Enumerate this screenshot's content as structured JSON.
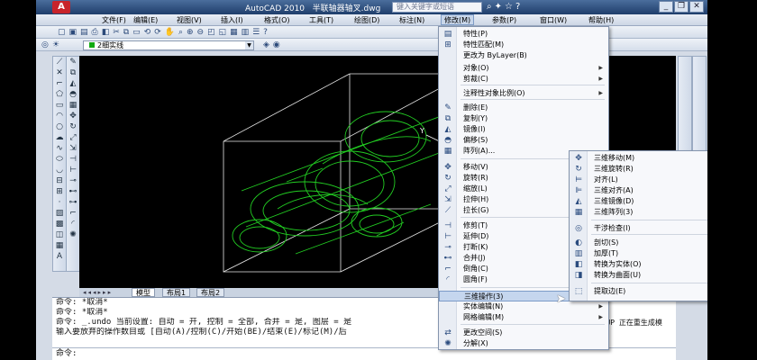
{
  "title": {
    "app": "AutoCAD 2010",
    "file": "半联轴器轴叉.dwg",
    "search_placeholder": "键入关键字或短语",
    "logo_text": "A"
  },
  "menubar": [
    {
      "label": "文件(F)"
    },
    {
      "label": "编辑(E)"
    },
    {
      "label": "视图(V)"
    },
    {
      "label": "插入(I)"
    },
    {
      "label": "格式(O)"
    },
    {
      "label": "工具(T)"
    },
    {
      "label": "绘图(D)"
    },
    {
      "label": "标注(N)"
    },
    {
      "label": "修改(M)"
    },
    {
      "label": "参数(P)"
    },
    {
      "label": "窗口(W)"
    },
    {
      "label": "帮助(H)"
    }
  ],
  "layer_combo": {
    "value": "2细实线"
  },
  "tabs": [
    {
      "label": "模型"
    },
    {
      "label": "布局1"
    },
    {
      "label": "布局2"
    }
  ],
  "command": {
    "lines": [
      "命令: *取消*",
      "命令: *取消*",
      "命令: _.undo 当前设置: 自动 = 开, 控制 = 全部, 合并 = 是, 图层 = 是",
      "输入要放弃的操作数目或 [自动(A)/控制(C)/开始(BE)/结束(E)/标记(M)/后"
    ],
    "prompt": "命令:",
    "overflow_text": "GROUP 正在重生成模"
  },
  "modify_menu": {
    "items": [
      {
        "icon": "properties-icon",
        "glyph": "▤",
        "label": "特性(P)",
        "arrow": false
      },
      {
        "icon": "match-properties-icon",
        "glyph": "⊞",
        "label": "特性匹配(M)",
        "arrow": false
      },
      {
        "icon": "",
        "glyph": "",
        "label": "更改为 ByLayer(B)",
        "arrow": false
      },
      {
        "icon": "",
        "glyph": "",
        "label": "对象(O)",
        "arrow": true
      },
      {
        "icon": "",
        "glyph": "",
        "label": "剪裁(C)",
        "arrow": true
      },
      {
        "icon": "",
        "glyph": "",
        "label": "注释性对象比例(O)",
        "arrow": true
      },
      {
        "icon": "erase-icon",
        "glyph": "✎",
        "label": "删除(E)",
        "arrow": false
      },
      {
        "icon": "copy-icon",
        "glyph": "⧉",
        "label": "复制(Y)",
        "arrow": false
      },
      {
        "icon": "mirror-icon",
        "glyph": "◭",
        "label": "镜像(I)",
        "arrow": false
      },
      {
        "icon": "offset-icon",
        "glyph": "◓",
        "label": "偏移(S)",
        "arrow": false
      },
      {
        "icon": "array-icon",
        "glyph": "▦",
        "label": "阵列(A)...",
        "arrow": false
      },
      {
        "icon": "move-icon",
        "glyph": "✥",
        "label": "移动(V)",
        "arrow": false
      },
      {
        "icon": "rotate-icon",
        "glyph": "↻",
        "label": "旋转(R)",
        "arrow": false
      },
      {
        "icon": "scale-icon",
        "glyph": "⤢",
        "label": "缩放(L)",
        "arrow": false
      },
      {
        "icon": "stretch-icon",
        "glyph": "⇲",
        "label": "拉伸(H)",
        "arrow": false
      },
      {
        "icon": "lengthen-icon",
        "glyph": "⟋",
        "label": "拉长(G)",
        "arrow": false
      },
      {
        "icon": "trim-icon",
        "glyph": "⊣",
        "label": "修剪(T)",
        "arrow": false
      },
      {
        "icon": "extend-icon",
        "glyph": "⊢",
        "label": "延伸(D)",
        "arrow": false
      },
      {
        "icon": "break-icon",
        "glyph": "⊸",
        "label": "打断(K)",
        "arrow": false
      },
      {
        "icon": "join-icon",
        "glyph": "⊷",
        "label": "合并(J)",
        "arrow": false
      },
      {
        "icon": "chamfer-icon",
        "glyph": "⌐",
        "label": "倒角(C)",
        "arrow": false
      },
      {
        "icon": "fillet-icon",
        "glyph": "◜",
        "label": "圆角(F)",
        "arrow": false
      },
      {
        "icon": "",
        "glyph": "",
        "label": "三维操作(3)",
        "arrow": true
      },
      {
        "icon": "",
        "glyph": "",
        "label": "实体编辑(N)",
        "arrow": true
      },
      {
        "icon": "",
        "glyph": "",
        "label": "网格编辑(M)",
        "arrow": true
      },
      {
        "icon": "change-space-icon",
        "glyph": "⇄",
        "label": "更改空间(S)",
        "arrow": false
      },
      {
        "icon": "explode-icon",
        "glyph": "✺",
        "label": "分解(X)",
        "arrow": false
      }
    ]
  },
  "submenu_3d": {
    "items": [
      {
        "icon": "3d-move-icon",
        "glyph": "✥",
        "label": "三维移动(M)"
      },
      {
        "icon": "3d-rotate-icon",
        "glyph": "↻",
        "label": "三维旋转(R)"
      },
      {
        "icon": "align-icon",
        "glyph": "⊨",
        "label": "对齐(L)"
      },
      {
        "icon": "3d-align-icon",
        "glyph": "⊫",
        "label": "三维对齐(A)"
      },
      {
        "icon": "3d-mirror-icon",
        "glyph": "◭",
        "label": "三维镜像(D)"
      },
      {
        "icon": "3d-array-icon",
        "glyph": "▦",
        "label": "三维阵列(3)"
      },
      {
        "icon": "interference-icon",
        "glyph": "◎",
        "label": "干涉检查(I)"
      },
      {
        "icon": "slice-icon",
        "glyph": "◐",
        "label": "剖切(S)"
      },
      {
        "icon": "thicken-icon",
        "glyph": "▥",
        "label": "加厚(T)"
      },
      {
        "icon": "convert-solid-icon",
        "glyph": "◧",
        "label": "转换为实体(O)"
      },
      {
        "icon": "convert-surface-icon",
        "glyph": "◨",
        "label": "转换为曲面(U)"
      },
      {
        "icon": "extract-edges-icon",
        "glyph": "⬚",
        "label": "提取边(E)"
      }
    ]
  }
}
